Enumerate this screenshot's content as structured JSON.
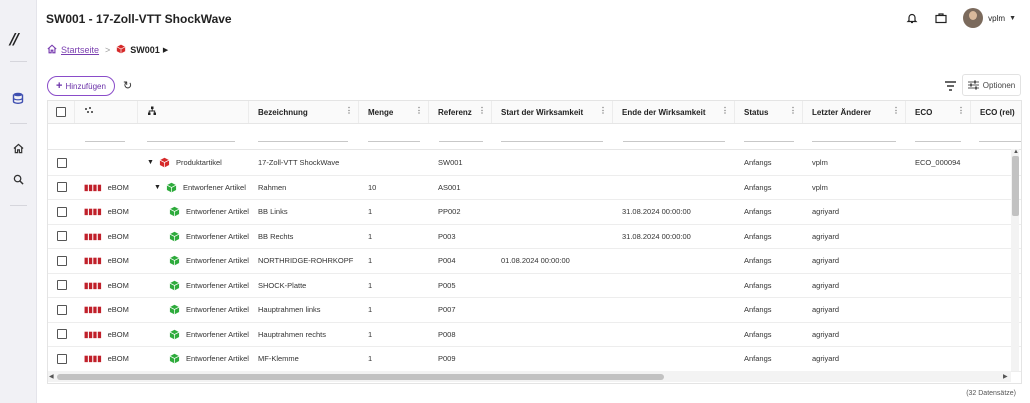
{
  "header": {
    "title": "SW001 - 17-Zoll-VTT ShockWave",
    "user_name": "vplm"
  },
  "breadcrumb": {
    "home": "Startseite",
    "separator": ">",
    "current": "SW001"
  },
  "toolbar": {
    "add_label": "Hinzufügen",
    "options_label": "Optionen"
  },
  "grid": {
    "columns": [
      "Bezeichnung",
      "Menge",
      "Referenz",
      "Start der Wirksamkeit",
      "Ende der Wirksamkeit",
      "Status",
      "Letzter Änderer",
      "ECO",
      "ECO (rel)"
    ],
    "rows": [
      {
        "bom": "",
        "type": "Produktartikel",
        "name": "17-Zoll-VTT ShockWave",
        "qty": "",
        "ref": "SW001",
        "start": "",
        "end": "",
        "status": "Anfangs",
        "changer": "vplm",
        "eco": "ECO_000094"
      },
      {
        "bom": "eBOM",
        "type": "Entworfener Artikel",
        "name": "Rahmen",
        "qty": "10",
        "ref": "AS001",
        "start": "",
        "end": "",
        "status": "Anfangs",
        "changer": "vplm",
        "eco": ""
      },
      {
        "bom": "eBOM",
        "type": "Entworfener Artikel",
        "name": "BB Links",
        "qty": "1",
        "ref": "PP002",
        "start": "",
        "end": "31.08.2024 00:00:00",
        "status": "Anfangs",
        "changer": "agriyard",
        "eco": ""
      },
      {
        "bom": "eBOM",
        "type": "Entworfener Artikel",
        "name": "BB Rechts",
        "qty": "1",
        "ref": "P003",
        "start": "",
        "end": "31.08.2024 00:00:00",
        "status": "Anfangs",
        "changer": "agriyard",
        "eco": ""
      },
      {
        "bom": "eBOM",
        "type": "Entworfener Artikel",
        "name": "NORTHRIDGE-ROHRKOPF",
        "qty": "1",
        "ref": "P004",
        "start": "01.08.2024 00:00:00",
        "end": "",
        "status": "Anfangs",
        "changer": "agriyard",
        "eco": ""
      },
      {
        "bom": "eBOM",
        "type": "Entworfener Artikel",
        "name": "SHOCK-Platte",
        "qty": "1",
        "ref": "P005",
        "start": "",
        "end": "",
        "status": "Anfangs",
        "changer": "agriyard",
        "eco": ""
      },
      {
        "bom": "eBOM",
        "type": "Entworfener Artikel",
        "name": "Hauptrahmen links",
        "qty": "1",
        "ref": "P007",
        "start": "",
        "end": "",
        "status": "Anfangs",
        "changer": "agriyard",
        "eco": ""
      },
      {
        "bom": "eBOM",
        "type": "Entworfener Artikel",
        "name": "Hauptrahmen rechts",
        "qty": "1",
        "ref": "P008",
        "start": "",
        "end": "",
        "status": "Anfangs",
        "changer": "agriyard",
        "eco": ""
      },
      {
        "bom": "eBOM",
        "type": "Entworfener Artikel",
        "name": "MF-Klemme",
        "qty": "1",
        "ref": "P009",
        "start": "",
        "end": "",
        "status": "Anfangs",
        "changer": "agriyard",
        "eco": ""
      }
    ],
    "record_count": "(32 Datensätze)"
  },
  "colors": {
    "accent": "#8a4cc9",
    "cube_red": "#d62a2a",
    "cube_green": "#2eab3c",
    "bom_red": "#c0202a"
  }
}
